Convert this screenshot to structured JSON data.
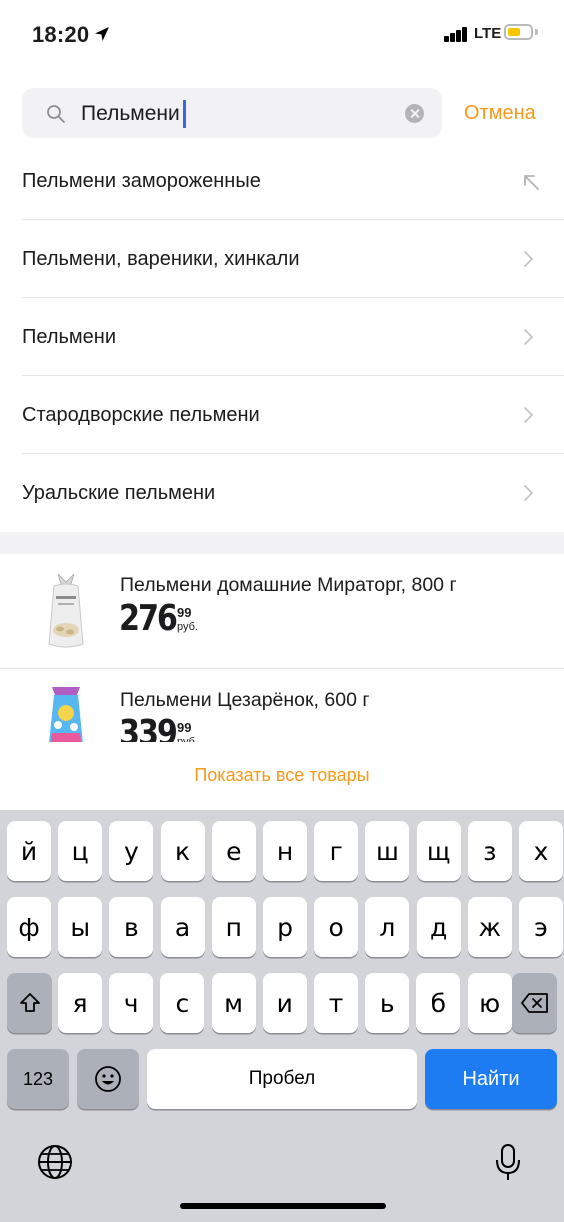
{
  "status_bar": {
    "time": "18:20",
    "network": "LTE",
    "battery_color": "#f7c600"
  },
  "search": {
    "query": "Пельмени",
    "cancel_label": "Отмена"
  },
  "suggestions": [
    {
      "label": "Пельмени замороженные",
      "icon": "arrow-up-left-icon"
    },
    {
      "label": "Пельмени, вареники, хинкали",
      "icon": "chevron-right-icon"
    },
    {
      "label": "Пельмени",
      "icon": "chevron-right-icon"
    },
    {
      "label": "Стародворские пельмени",
      "icon": "chevron-right-icon"
    },
    {
      "label": "Уральские пельмени",
      "icon": "chevron-right-icon"
    }
  ],
  "products": [
    {
      "name": "Пельмени домашние Мираторг, 800 г",
      "price_rub": "276",
      "price_kop": "99",
      "currency": "руб."
    },
    {
      "name": "Пельмени Цезарёнок, 600 г",
      "price_rub": "339",
      "price_kop": "99",
      "currency": "руб."
    }
  ],
  "show_all_label": "Показать все товары",
  "keyboard": {
    "row1": [
      "й",
      "ц",
      "у",
      "к",
      "е",
      "н",
      "г",
      "ш",
      "щ",
      "з",
      "х"
    ],
    "row2": [
      "ф",
      "ы",
      "в",
      "а",
      "п",
      "р",
      "о",
      "л",
      "д",
      "ж",
      "э"
    ],
    "row3": [
      "я",
      "ч",
      "с",
      "м",
      "и",
      "т",
      "ь",
      "б",
      "ю"
    ],
    "numbers_label": "123",
    "space_label": "Пробел",
    "go_label": "Найти"
  },
  "colors": {
    "accent": "#f7991a",
    "go_button": "#1e7cf2",
    "keyboard_bg": "#d2d4d9"
  }
}
